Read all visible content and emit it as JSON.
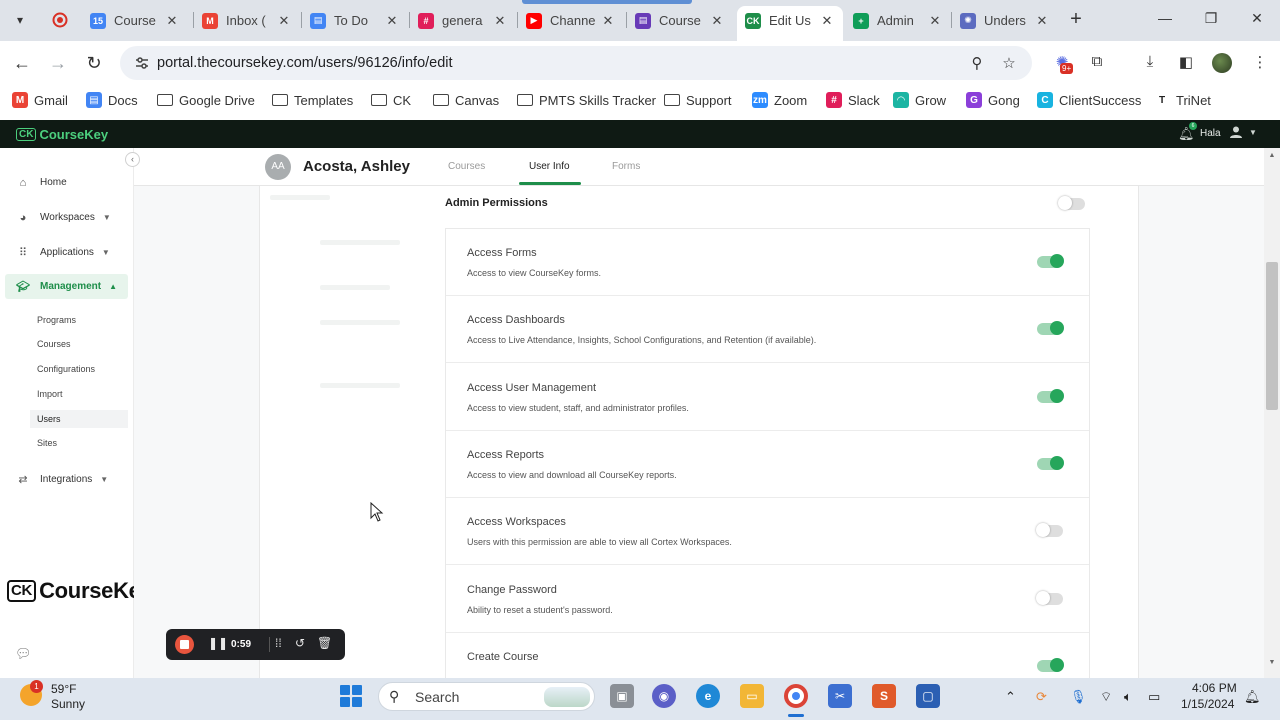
{
  "browser": {
    "tabs": [
      {
        "label": "Course",
        "color": "#4285f4",
        "glyph": "15"
      },
      {
        "label": "Inbox (",
        "color": "#ea4335",
        "glyph": "M"
      },
      {
        "label": "To Do",
        "color": "#4285f4",
        "glyph": "▤"
      },
      {
        "label": "genera",
        "color": "#e01e5a",
        "glyph": "#"
      },
      {
        "label": "Channe",
        "color": "#ff0000",
        "glyph": "▶"
      },
      {
        "label": "Course",
        "color": "#673ab7",
        "glyph": "▤"
      },
      {
        "label": "Edit Us",
        "color": "#1e8e4a",
        "glyph": "CK"
      },
      {
        "label": "Admin",
        "color": "#0f9d58",
        "glyph": "+"
      },
      {
        "label": "Unders",
        "color": "#5c6bc0",
        "glyph": "✺"
      }
    ],
    "url": "portal.thecoursekey.com/users/96126/info/edit",
    "extension_badge": "9+",
    "bookmarks": [
      {
        "label": "Gmail",
        "kind": "gmail"
      },
      {
        "label": "Docs",
        "kind": "docs"
      },
      {
        "label": "Google Drive",
        "kind": "folder"
      },
      {
        "label": "Templates",
        "kind": "folder"
      },
      {
        "label": "CK",
        "kind": "folder"
      },
      {
        "label": "Canvas",
        "kind": "folder"
      },
      {
        "label": "PMTS Skills Tracker",
        "kind": "folder"
      },
      {
        "label": "Support",
        "kind": "folder"
      },
      {
        "label": "Zoom",
        "kind": "zoom"
      },
      {
        "label": "Slack",
        "kind": "slack"
      },
      {
        "label": "Grow",
        "kind": "grow"
      },
      {
        "label": "Gong",
        "kind": "gong"
      },
      {
        "label": "ClientSuccess",
        "kind": "clientsuccess"
      },
      {
        "label": "TriNet",
        "kind": "trinet"
      }
    ]
  },
  "app": {
    "brand": "CourseKey",
    "brand_mark": "CK",
    "user": "Hala",
    "notification_count": "6"
  },
  "sidebar": {
    "items": [
      {
        "label": "Home",
        "icon": "home-icon"
      },
      {
        "label": "Workspaces",
        "icon": "pie-chart-icon"
      },
      {
        "label": "Applications",
        "icon": "grid-icon"
      },
      {
        "label": "Management",
        "icon": "graduation-cap-icon"
      },
      {
        "label": "Integrations",
        "icon": "integrations-icon"
      }
    ],
    "management_children": [
      "Programs",
      "Courses",
      "Configurations",
      "Import",
      "Users",
      "Sites"
    ],
    "current_child": "Users",
    "footer_logo": "CourseKey"
  },
  "profile": {
    "initials": "AA",
    "name": "Acosta, Ashley",
    "tabs": [
      "Courses",
      "User Info",
      "Forms"
    ],
    "active_tab": "User Info"
  },
  "permissions": {
    "section_title": "Admin Permissions",
    "section_enabled": false,
    "items": [
      {
        "name": "Access Forms",
        "description": "Access to view CourseKey forms.",
        "enabled": true
      },
      {
        "name": "Access Dashboards",
        "description": "Access to Live Attendance, Insights, School Configurations, and Retention (if available).",
        "enabled": true
      },
      {
        "name": "Access User Management",
        "description": "Access to view student, staff, and administrator profiles.",
        "enabled": true
      },
      {
        "name": "Access Reports",
        "description": "Access to view and download all CourseKey reports.",
        "enabled": true
      },
      {
        "name": "Access Workspaces",
        "description": "Users with this permission are able to view all Cortex Workspaces.",
        "enabled": false
      },
      {
        "name": "Change Password",
        "description": "Ability to reset a student's password.",
        "enabled": false
      },
      {
        "name": "Create Course",
        "description": "",
        "enabled": true
      }
    ]
  },
  "recorder": {
    "elapsed": "0:59"
  },
  "taskbar": {
    "weather_badge": "1",
    "temperature": "59°F",
    "condition": "Sunny",
    "search_placeholder": "Search",
    "time": "4:06 PM",
    "date": "1/15/2024"
  },
  "colors": {
    "accent_green": "#26a65b",
    "header_dark": "#0f1a14"
  }
}
